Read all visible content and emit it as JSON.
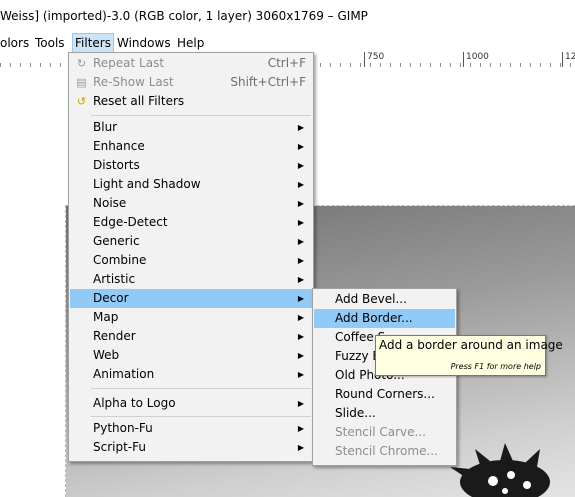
{
  "window": {
    "title": "Weiss] (imported)-3.0 (RGB color, 1 layer) 3060x1769 – GIMP"
  },
  "menubar": {
    "items": [
      {
        "label": "olors",
        "active": false
      },
      {
        "label": "Tools",
        "active": false
      },
      {
        "label": "Filters",
        "active": true
      },
      {
        "label": "Windows",
        "active": false
      },
      {
        "label": "Help",
        "active": false
      }
    ]
  },
  "ruler": {
    "labels": [
      "750",
      "1000",
      "12"
    ]
  },
  "filters_menu": {
    "items": [
      {
        "label": "Repeat Last",
        "shortcut": "Ctrl+F",
        "icon": "repeat-icon",
        "disabled": true
      },
      {
        "label": "Re-Show Last",
        "shortcut": "Shift+Ctrl+F",
        "icon": "reshow-icon",
        "disabled": true
      },
      {
        "label": "Reset all Filters",
        "icon": "reset-icon"
      },
      {
        "label": "Blur"
      },
      {
        "label": "Enhance"
      },
      {
        "label": "Distorts"
      },
      {
        "label": "Light and Shadow"
      },
      {
        "label": "Noise"
      },
      {
        "label": "Edge-Detect"
      },
      {
        "label": "Generic"
      },
      {
        "label": "Combine"
      },
      {
        "label": "Artistic"
      },
      {
        "label": "Decor",
        "highlight": true
      },
      {
        "label": "Map"
      },
      {
        "label": "Render"
      },
      {
        "label": "Web"
      },
      {
        "label": "Animation"
      },
      {
        "label": "Alpha to Logo"
      },
      {
        "label": "Python-Fu"
      },
      {
        "label": "Script-Fu"
      }
    ]
  },
  "decor_menu": {
    "items": [
      {
        "label": "Add Bevel..."
      },
      {
        "label": "Add Border...",
        "highlight": true
      },
      {
        "label": "Coffee S"
      },
      {
        "label": "Fuzzy Bo"
      },
      {
        "label": "Old Photo..."
      },
      {
        "label": "Round Corners..."
      },
      {
        "label": "Slide..."
      },
      {
        "label": "Stencil Carve...",
        "disabled": true
      },
      {
        "label": "Stencil Chrome...",
        "disabled": true
      }
    ]
  },
  "tooltip": {
    "text": "Add a border around an image",
    "hint": "Press F1 for more help"
  },
  "colors": {
    "highlight": "#91c9f7",
    "menu_bg": "#f2f2f2",
    "tooltip_bg": "#ffffe1"
  }
}
